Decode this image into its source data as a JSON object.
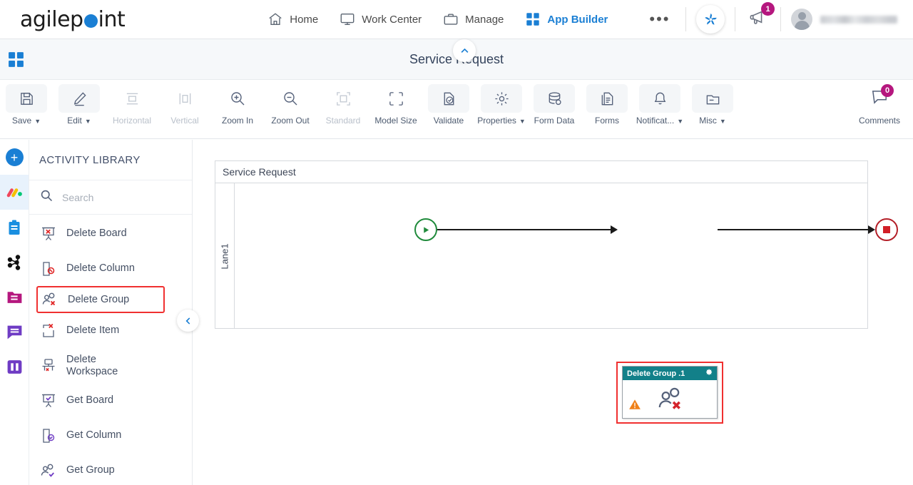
{
  "brand": {
    "name": "agilepoint",
    "accent": "#1a7fd4"
  },
  "topnav": {
    "items": [
      {
        "label": "Home",
        "icon": "home-icon",
        "active": false
      },
      {
        "label": "Work Center",
        "icon": "monitor-icon",
        "active": false
      },
      {
        "label": "Manage",
        "icon": "briefcase-icon",
        "active": false
      },
      {
        "label": "App Builder",
        "icon": "grid-icon",
        "active": true
      }
    ],
    "overflow_label": "•••",
    "apps_icon": "pinwheel-icon",
    "announcements_icon": "megaphone-icon",
    "announcements_count": "1",
    "avatar_icon": "user-avatar-icon",
    "username": ""
  },
  "titlebar": {
    "apps_grid_icon": "grid-blue-icon",
    "title": "Service Request",
    "collapse_icon": "chevron-up-icon"
  },
  "toolbar": {
    "items": [
      {
        "label": "Save",
        "icon": "save-icon",
        "dropdown": true,
        "disabled": false
      },
      {
        "label": "Edit",
        "icon": "edit-pencil-icon",
        "dropdown": true,
        "disabled": false
      },
      {
        "label": "Horizontal",
        "icon": "horizontal-layout-icon",
        "dropdown": false,
        "disabled": true
      },
      {
        "label": "Vertical",
        "icon": "vertical-layout-icon",
        "dropdown": false,
        "disabled": true
      },
      {
        "label": "Zoom In",
        "icon": "zoom-in-icon",
        "dropdown": false,
        "disabled": false
      },
      {
        "label": "Zoom Out",
        "icon": "zoom-out-icon",
        "dropdown": false,
        "disabled": false
      },
      {
        "label": "Standard",
        "icon": "standard-size-icon",
        "dropdown": false,
        "disabled": true
      },
      {
        "label": "Model Size",
        "icon": "model-size-icon",
        "dropdown": false,
        "disabled": false
      },
      {
        "label": "Validate",
        "icon": "validate-icon",
        "dropdown": false,
        "disabled": false
      },
      {
        "label": "Properties",
        "icon": "gear-icon",
        "dropdown": true,
        "disabled": false
      },
      {
        "label": "Form Data",
        "icon": "database-icon",
        "dropdown": false,
        "disabled": false
      },
      {
        "label": "Forms",
        "icon": "document-icon",
        "dropdown": false,
        "disabled": false
      },
      {
        "label": "Notificat...",
        "icon": "bell-icon",
        "dropdown": true,
        "disabled": false
      },
      {
        "label": "Misc",
        "icon": "folder-card-icon",
        "dropdown": true,
        "disabled": false
      }
    ],
    "comments": {
      "label": "Comments",
      "icon": "comment-bubble-icon",
      "count": "0"
    },
    "badge_color": "#b5177e"
  },
  "rail": {
    "items": [
      {
        "name": "add-button",
        "icon": "plus-circle-icon",
        "selected": false
      },
      {
        "name": "monday-icon",
        "icon": "monday-logo-icon",
        "selected": true
      },
      {
        "name": "clipboard-icon",
        "icon": "clipboard-icon",
        "selected": false
      },
      {
        "name": "share-nodes-icon",
        "icon": "network-nodes-icon",
        "selected": false
      },
      {
        "name": "folder-icon",
        "icon": "folder-icon",
        "selected": false
      },
      {
        "name": "chat-icon",
        "icon": "chat-bubble-icon",
        "selected": false
      },
      {
        "name": "columns-icon",
        "icon": "columns-icon",
        "selected": false
      }
    ]
  },
  "library": {
    "title": "ACTIVITY LIBRARY",
    "search_placeholder": "Search",
    "search_value": "",
    "search_icon": "search-icon",
    "collapse_icon": "chevron-left-icon",
    "items": [
      {
        "label": "Delete Board",
        "icon": "delete-board-icon",
        "highlight": false
      },
      {
        "label": "Delete Column",
        "icon": "delete-column-icon",
        "highlight": false
      },
      {
        "label": "Delete Group",
        "icon": "delete-group-icon",
        "highlight": true
      },
      {
        "label": "Delete Item",
        "icon": "delete-item-icon",
        "highlight": false
      },
      {
        "label": "Delete Workspace",
        "icon": "delete-workspace-icon",
        "highlight": false
      },
      {
        "label": "Get Board",
        "icon": "get-board-icon",
        "highlight": false
      },
      {
        "label": "Get Column",
        "icon": "get-column-icon",
        "highlight": false
      },
      {
        "label": "Get Group",
        "icon": "get-group-icon",
        "highlight": false
      }
    ],
    "highlight_color": "#f03030"
  },
  "canvas": {
    "pool_title": "Service Request",
    "lane_label": "Lane1",
    "start_event": {
      "name": "start-event",
      "icon": "play-icon",
      "color": "#1f8a3b"
    },
    "end_event": {
      "name": "end-event",
      "icon": "stop-square-icon",
      "color": "#b41f28"
    },
    "activity": {
      "title": "Delete Group .1",
      "header_color": "#128089",
      "gear_icon": "gear-icon",
      "warning_icon": "warning-triangle-icon",
      "body_icon": "delete-group-icon",
      "selected": true,
      "selection_color": "#f03030"
    }
  }
}
